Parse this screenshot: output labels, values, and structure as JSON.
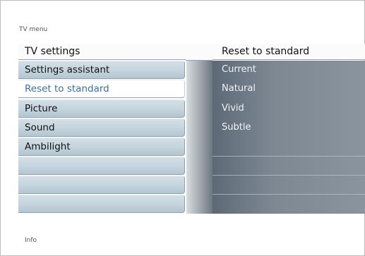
{
  "breadcrumb": "TV menu",
  "left_column": {
    "title": "TV settings",
    "items": [
      {
        "label": "Settings assistant",
        "selected": false
      },
      {
        "label": "Reset to standard",
        "selected": true
      },
      {
        "label": "Picture",
        "selected": false
      },
      {
        "label": "Sound",
        "selected": false
      },
      {
        "label": "Ambilight",
        "selected": false
      },
      {
        "label": "",
        "selected": false
      },
      {
        "label": "",
        "selected": false
      },
      {
        "label": "",
        "selected": false
      }
    ]
  },
  "right_column": {
    "title": "Reset to standard",
    "options": [
      "Current",
      "Natural",
      "Vivid",
      "Subtle"
    ]
  },
  "footer": {
    "info": "Info"
  }
}
